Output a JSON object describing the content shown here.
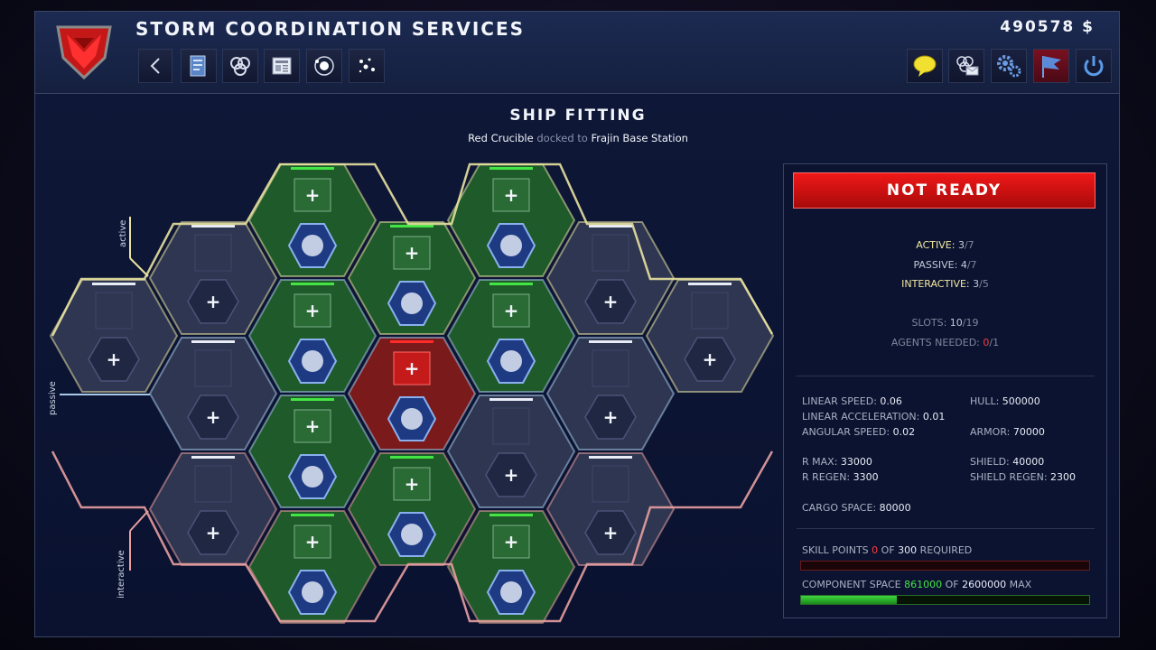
{
  "header": {
    "app_title": "STORM COORDINATION SERVICES",
    "money": "490578 $",
    "nav_buttons": [
      "back-icon",
      "document-icon",
      "triangle-knot-icon",
      "news-icon",
      "orbit-icon",
      "stars-icon"
    ],
    "top_buttons": [
      "chat-icon",
      "mail-icon",
      "settings-icon",
      "flag-icon",
      "power-icon"
    ]
  },
  "page": {
    "title": "SHIP FITTING",
    "ship": "Red Crucible",
    "docked_word": "docked to",
    "station": "Frajin Base Station"
  },
  "slot_groups": {
    "active_label": "active",
    "passive_label": "passive",
    "interactive_label": "interactive"
  },
  "panel": {
    "status": "NOT READY",
    "active_label": "ACTIVE:",
    "active_val": "3",
    "active_max": "/7",
    "passive_label": "PASSIVE:",
    "passive_val": "4",
    "passive_max": "/7",
    "interactive_label": "INTERACTIVE:",
    "interactive_val": "3",
    "interactive_max": "/5",
    "slots_label": "SLOTS:",
    "slots_val": "10",
    "slots_max": "/19",
    "agents_label": "AGENTS NEEDED:",
    "agents_val": "0",
    "agents_max": "/1",
    "stats": {
      "linear_speed": "LINEAR SPEED:",
      "linear_speed_v": "0.06",
      "linear_accel": "LINEAR ACCELERATION:",
      "linear_accel_v": "0.01",
      "angular_speed": "ANGULAR SPEED:",
      "angular_speed_v": "0.02",
      "hull": "HULL:",
      "hull_v": "500000",
      "armor": "ARMOR:",
      "armor_v": "70000",
      "r_max": "R MAX:",
      "r_max_v": "33000",
      "r_regen": "R REGEN:",
      "r_regen_v": "3300",
      "shield": "SHIELD:",
      "shield_v": "40000",
      "shield_regen": "SHIELD REGEN:",
      "shield_regen_v": "2300",
      "cargo": "CARGO SPACE:",
      "cargo_v": "80000"
    },
    "skill_label": "SKILL POINTS",
    "skill_val": "0",
    "skill_of": "OF",
    "skill_max": "300",
    "skill_req": "REQUIRED",
    "skill_fill": 0,
    "comp_label": "COMPONENT SPACE",
    "comp_val": "861000",
    "comp_of": "OF",
    "comp_max": "2600000",
    "comp_req": "MAX",
    "comp_fill": 0.331
  },
  "colors": {
    "active": "#e8e2a0",
    "passive": "#a8c8e8",
    "interactive": "#e8a0a0",
    "filled_slot": "#1f5a2a",
    "empty_slot": "#2f3652",
    "error_slot": "#7a1a1a",
    "accent_green": "#45e445",
    "accent_red": "#ff2a2a"
  },
  "slots": [
    {
      "group": "active",
      "state": "empty",
      "icon": "",
      "plus": "+"
    },
    {
      "group": "active",
      "state": "empty",
      "icon": "",
      "plus": "+"
    },
    {
      "group": "active",
      "state": "filled",
      "icon": "fire-icon",
      "plus": "+"
    },
    {
      "group": "active",
      "state": "filled",
      "icon": "drill-icon",
      "plus": "+"
    },
    {
      "group": "active",
      "state": "filled",
      "icon": "energy-cluster-icon",
      "plus": "+"
    },
    {
      "group": "active",
      "state": "empty",
      "icon": "",
      "plus": "+"
    },
    {
      "group": "active",
      "state": "empty",
      "icon": "",
      "plus": "+"
    },
    {
      "group": "passive",
      "state": "empty",
      "icon": "",
      "plus": "+"
    },
    {
      "group": "passive",
      "state": "filled",
      "icon": "hex-plates-icon",
      "plus": "+"
    },
    {
      "group": "passive",
      "state": "error",
      "icon": "gears-icon",
      "plus": "+"
    },
    {
      "group": "passive",
      "state": "filled",
      "icon": "waveform-icon",
      "plus": "+"
    },
    {
      "group": "passive",
      "state": "empty",
      "icon": "",
      "plus": "+"
    },
    {
      "group": "passive",
      "state": "filled",
      "icon": "cell-grid-icon",
      "plus": "+"
    },
    {
      "group": "passive",
      "state": "empty",
      "icon": "",
      "plus": "+"
    },
    {
      "group": "interactive",
      "state": "empty",
      "icon": "",
      "plus": "+"
    },
    {
      "group": "interactive",
      "state": "filled",
      "icon": "tractor-beam-icon",
      "plus": "+"
    },
    {
      "group": "interactive",
      "state": "empty",
      "icon": "",
      "plus": "+"
    },
    {
      "group": "interactive",
      "state": "filled",
      "icon": "tractor-beam-icon",
      "plus": "+"
    },
    {
      "group": "interactive",
      "state": "filled",
      "icon": "crosshair-icon",
      "plus": "+"
    }
  ]
}
